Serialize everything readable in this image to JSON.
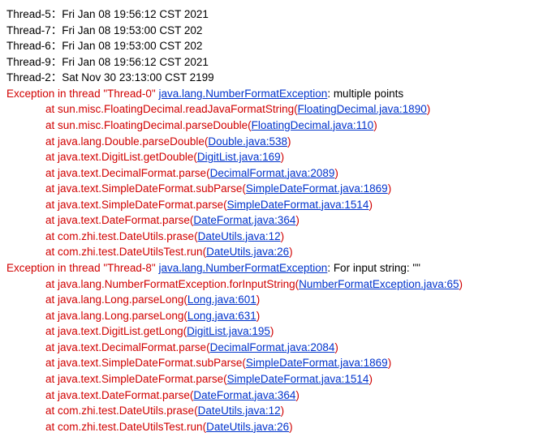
{
  "logs": {
    "l0": "Thread-5：Fri Jan 08 19:56:12 CST 2021",
    "l1": "Thread-7：Fri Jan 08 19:53:00 CST 202",
    "l2": "Thread-6：Fri Jan 08 19:53:00 CST 202",
    "l3": "Thread-9：Fri Jan 08 19:56:12 CST 2021",
    "l4": "Thread-2：Sat Nov 30 23:13:00 CST 2199"
  },
  "ex1": {
    "head_pre": "Exception in thread \"Thread-0\" ",
    "head_link": "java.lang.NumberFormatException",
    "head_post": ": multiple points",
    "frames": [
      {
        "pre": "at sun.misc.FloatingDecimal.readJavaFormatString(",
        "link": "FloatingDecimal.java:1890",
        "post": ")"
      },
      {
        "pre": "at sun.misc.FloatingDecimal.parseDouble(",
        "link": "FloatingDecimal.java:110",
        "post": ")"
      },
      {
        "pre": "at java.lang.Double.parseDouble(",
        "link": "Double.java:538",
        "post": ")"
      },
      {
        "pre": "at java.text.DigitList.getDouble(",
        "link": "DigitList.java:169",
        "post": ")"
      },
      {
        "pre": "at java.text.DecimalFormat.parse(",
        "link": "DecimalFormat.java:2089",
        "post": ")"
      },
      {
        "pre": "at java.text.SimpleDateFormat.subParse(",
        "link": "SimpleDateFormat.java:1869",
        "post": ")"
      },
      {
        "pre": "at java.text.SimpleDateFormat.parse(",
        "link": "SimpleDateFormat.java:1514",
        "post": ")"
      },
      {
        "pre": "at java.text.DateFormat.parse(",
        "link": "DateFormat.java:364",
        "post": ")"
      },
      {
        "pre": "at com.zhi.test.DateUtils.prase(",
        "link": "DateUtils.java:12",
        "post": ")"
      },
      {
        "pre": "at com.zhi.test.DateUtilsTest.run(",
        "link": "DateUtils.java:26",
        "post": ")"
      }
    ]
  },
  "ex2": {
    "head_pre": "Exception in thread \"Thread-8\" ",
    "head_link": "java.lang.NumberFormatException",
    "head_post": ": For input string: \"\"",
    "frames": [
      {
        "pre": "at java.lang.NumberFormatException.forInputString(",
        "link": "NumberFormatException.java:65",
        "post": ")"
      },
      {
        "pre": "at java.lang.Long.parseLong(",
        "link": "Long.java:601",
        "post": ")"
      },
      {
        "pre": "at java.lang.Long.parseLong(",
        "link": "Long.java:631",
        "post": ")"
      },
      {
        "pre": "at java.text.DigitList.getLong(",
        "link": "DigitList.java:195",
        "post": ")"
      },
      {
        "pre": "at java.text.DecimalFormat.parse(",
        "link": "DecimalFormat.java:2084",
        "post": ")"
      },
      {
        "pre": "at java.text.SimpleDateFormat.subParse(",
        "link": "SimpleDateFormat.java:1869",
        "post": ")"
      },
      {
        "pre": "at java.text.SimpleDateFormat.parse(",
        "link": "SimpleDateFormat.java:1514",
        "post": ")"
      },
      {
        "pre": "at java.text.DateFormat.parse(",
        "link": "DateFormat.java:364",
        "post": ")"
      },
      {
        "pre": "at com.zhi.test.DateUtils.prase(",
        "link": "DateUtils.java:12",
        "post": ")"
      },
      {
        "pre": "at com.zhi.test.DateUtilsTest.run(",
        "link": "DateUtils.java:26",
        "post": ")"
      }
    ]
  }
}
